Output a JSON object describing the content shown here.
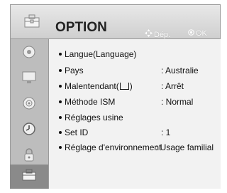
{
  "header": {
    "title": "OPTION",
    "nav_hint": "Dép.",
    "ok_hint": "OK",
    "icon": "toolbox-icon"
  },
  "sidebar": {
    "items": [
      {
        "icon": "picture-icon"
      },
      {
        "icon": "monitor-icon"
      },
      {
        "icon": "audio-icon"
      },
      {
        "icon": "clock-icon"
      },
      {
        "icon": "lock-icon"
      },
      {
        "icon": "option-icon",
        "selected": true
      }
    ]
  },
  "menu": {
    "rows": [
      {
        "label": "Langue(Language)",
        "value": ""
      },
      {
        "label": "Pays",
        "value": ": Australie"
      },
      {
        "label_a": "Malentendant(",
        "label_b": ")",
        "value": ": Arrêt"
      },
      {
        "label": "Méthode ISM",
        "value": ": Normal"
      },
      {
        "label": "Réglages usine",
        "value": ""
      },
      {
        "label": "Set ID",
        "value": ": 1"
      },
      {
        "label": "Réglage d'environnement",
        "value": ": Usage familial"
      }
    ]
  }
}
